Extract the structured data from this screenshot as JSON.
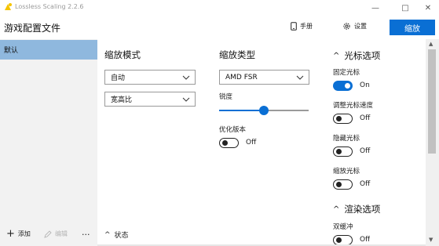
{
  "window": {
    "title": "Lossless Scaling 2.2.6",
    "minimize_glyph": "—",
    "maximize_glyph": "□",
    "close_glyph": "✕"
  },
  "header": {
    "title": "游戏配置文件",
    "manual_label": "手册",
    "settings_label": "设置",
    "scale_button": "缩放"
  },
  "sidebar": {
    "profiles": [
      "默认"
    ],
    "add_label": "添加",
    "edit_label": "编辑",
    "more_label": "..."
  },
  "status": {
    "label": "状态",
    "chevron": "^"
  },
  "scaling_mode": {
    "title": "缩放模式",
    "mode_value": "自动",
    "aspect_value": "宽高比"
  },
  "scaling_type": {
    "title": "缩放类型",
    "type_value": "AMD FSR",
    "sharpness_label": "锐度",
    "sharpness_level": 0.5,
    "optimize_label": "优化版本",
    "optimize_state": "Off"
  },
  "cursor_options": {
    "title": "光标选项",
    "chevron": "^",
    "items": [
      {
        "label": "固定光标",
        "state": "On"
      },
      {
        "label": "调整光标速度",
        "state": "Off"
      },
      {
        "label": "隐藏光标",
        "state": "Off"
      },
      {
        "label": "缩放光标",
        "state": "Off"
      }
    ]
  },
  "render_options": {
    "title": "渲染选项",
    "chevron": "^",
    "items": [
      {
        "label": "双缓冲",
        "state": "Off"
      }
    ]
  },
  "colors": {
    "accent": "#0a6fd4",
    "selected_profile": "#8fb8de",
    "sidebar_bg": "#f2f2f2"
  }
}
